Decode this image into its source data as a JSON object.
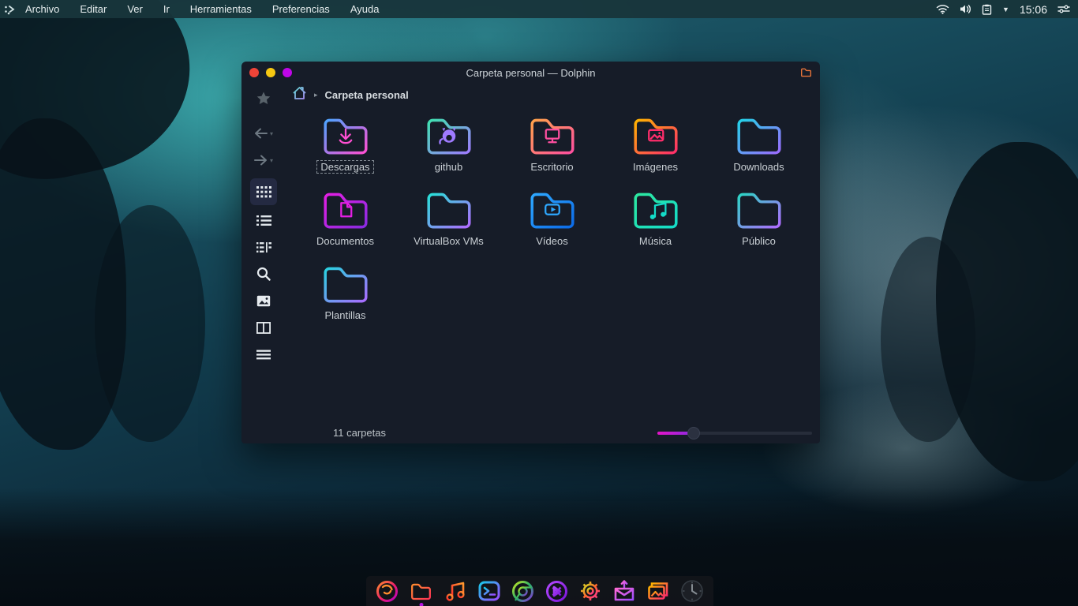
{
  "menubar": {
    "logo_icon": "distro-logo",
    "items": [
      "Archivo",
      "Editar",
      "Ver",
      "Ir",
      "Herramientas",
      "Preferencias",
      "Ayuda"
    ],
    "tray": {
      "icons": [
        "wifi-icon",
        "volume-icon",
        "clipboard-icon",
        "caret-down-icon"
      ],
      "caret": "▼",
      "time": "15:06",
      "right_icon": "sliders-icon"
    }
  },
  "window": {
    "title": "Carpeta personal — Dolphin",
    "app_icon": "folder-icon",
    "traffic_lights": {
      "close": "#ef4438",
      "minimize": "#f6c812",
      "maximize": "#bf06e8"
    },
    "breadcrumb": {
      "home_icon": "home-icon",
      "separator": "▸",
      "path": "Carpeta personal"
    },
    "toolbar_icons": [
      "bookmark-star",
      "back",
      "forward",
      "icons-view",
      "details-view",
      "compact-view",
      "search",
      "preview",
      "split-view",
      "hamburger-menu"
    ],
    "statusbar": {
      "count": "11 carpetas"
    }
  },
  "folders": [
    {
      "name": "Descargas",
      "glyph": "download-arrow",
      "colors": [
        "#4da3ff",
        "#ff4fd2"
      ],
      "focused": true
    },
    {
      "name": "github",
      "glyph": "octocat",
      "colors": [
        "#3fe0b0",
        "#9f7bff"
      ]
    },
    {
      "name": "Escritorio",
      "glyph": "monitor",
      "colors": [
        "#ffa24a",
        "#ff4fa0"
      ]
    },
    {
      "name": "Imágenes",
      "glyph": "image",
      "colors": [
        "#ffb300",
        "#ff2d6b"
      ]
    },
    {
      "name": "Downloads",
      "glyph": "none",
      "colors": [
        "#23d2e8",
        "#9b6bff"
      ]
    },
    {
      "name": "Documentos",
      "glyph": "document",
      "colors": [
        "#e31fe3",
        "#8a2be2"
      ]
    },
    {
      "name": "VirtualBox VMs",
      "glyph": "none",
      "colors": [
        "#27e0d8",
        "#b06bff"
      ]
    },
    {
      "name": "Vídeos",
      "glyph": "video-play",
      "colors": [
        "#2ea8ff",
        "#0c6be8"
      ]
    },
    {
      "name": "Música",
      "glyph": "music-note",
      "colors": [
        "#2de8a0",
        "#14dcc8"
      ]
    },
    {
      "name": "Público",
      "glyph": "none",
      "colors": [
        "#2bd4c4",
        "#b06bff"
      ]
    },
    {
      "name": "Plantillas",
      "glyph": "none",
      "colors": [
        "#29d2e0",
        "#a96bff"
      ]
    }
  ],
  "dock": {
    "items": [
      {
        "name": "firefox",
        "running": false
      },
      {
        "name": "file-manager",
        "running": true
      },
      {
        "name": "music-player",
        "running": false
      },
      {
        "name": "terminal",
        "running": false
      },
      {
        "name": "chromium",
        "running": false
      },
      {
        "name": "media-player",
        "running": false
      },
      {
        "name": "settings",
        "running": false
      },
      {
        "name": "mail",
        "running": false
      },
      {
        "name": "photos",
        "running": false
      },
      {
        "name": "clock",
        "running": false
      }
    ],
    "indicator_color": "#b414e0"
  },
  "colors": {
    "accent": "#bf06e8",
    "slider_fill": "#d414d4",
    "topbar": "#18353b",
    "window_bg": "#161c28"
  }
}
